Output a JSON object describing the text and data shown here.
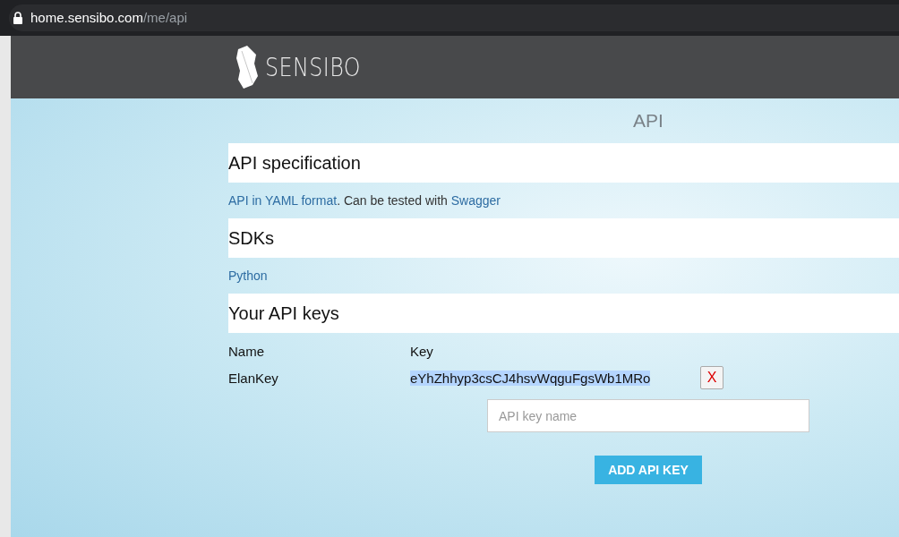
{
  "browser": {
    "url_host": "home.sensibo.com",
    "url_path": "/me/api"
  },
  "header": {
    "logo_text": "SENSIBO"
  },
  "page_title": "API",
  "sections": [
    {
      "title": "API specification",
      "kind": "links",
      "parts": [
        {
          "kind": "link",
          "text": "API in YAML format"
        },
        {
          "kind": "text",
          "text": ". Can be tested with "
        },
        {
          "kind": "link",
          "text": "Swagger"
        }
      ]
    },
    {
      "title": "SDKs",
      "kind": "links",
      "parts": [
        {
          "kind": "link",
          "text": "Python"
        }
      ]
    },
    {
      "title": "Your API keys",
      "kind": "keys",
      "columns": [
        "Name",
        "Key"
      ],
      "rows": [
        {
          "name": "ElanKey",
          "key": "eYhZhhyp3csCJ4hsvWqguFgsWb1MRo",
          "highlighted": true,
          "delete_label": "X"
        }
      ],
      "new_key": {
        "placeholder": "API key name"
      },
      "add_button": "ADD API KEY"
    }
  ]
}
